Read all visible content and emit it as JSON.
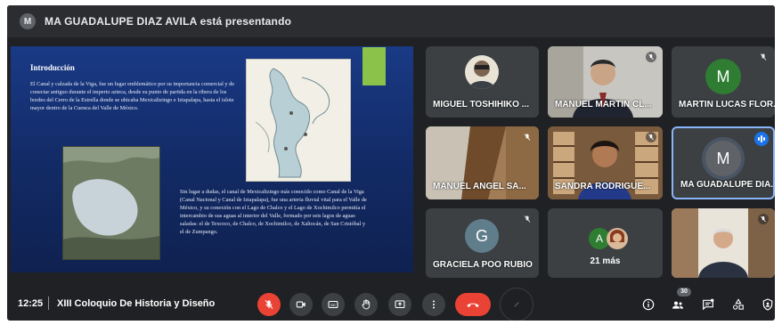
{
  "topbar": {
    "presenter_initial": "M",
    "presenter_text": "MA GUADALUPE DIAZ AVILA está presentando"
  },
  "slide": {
    "title": "Introducción",
    "paragraph_1": "El Canal y calzada de la Viga, fue un lugar emblemático por su importancia comercial y de conectar antiguo durante el imperio azteca, desde su punto de partida en la ribera de los bordes del Cerro de la Estrella donde se ubicaba Mexicaltzingo e Iztapalapa, hasta el islote mayor dentro de la Cuenca del Valle de México.",
    "paragraph_2": "Sin lugar a dudas, el canal de Mexicaltzingo más conocido como Canal de la Viga (Canal Nacional y Canal de Iztapalapa), fue una arteria fluvial vital para el Valle de México, y su conexión con el Lago de Chalco y el Lago de Xochimilco permitía el intercambio de sus aguas al interior del Valle, formado por seis lagos de aguas saladas: el de Texcoco, de Chalco, de Xochimilco, de Xaltocán, de San Cristóbal y el de Zumpango.",
    "accent_color": "#8bc34a"
  },
  "participants": [
    {
      "name": "MIGUEL TOSHIHIKO ...",
      "muted": false
    },
    {
      "name": "MANUEL MARTIN CL...",
      "muted": true
    },
    {
      "name": "MARTIN LUCAS FLOR...",
      "initial": "M",
      "avatar_color": "#2e7d32",
      "muted": true
    },
    {
      "name": "MANUEL ANGEL SA...",
      "muted": true
    },
    {
      "name": "SANDRA RODRIGUE...",
      "muted": true
    },
    {
      "name": "MA GUADALUPE DIA...",
      "initial": "M",
      "avatar_color": "#5f6368",
      "speaking": true
    },
    {
      "name": "GRACIELA POO RUBIO",
      "initial": "G",
      "avatar_color": "#607d8b",
      "muted": true
    },
    {
      "name": "21 más",
      "initial": "A",
      "avatar_color": "#2e7d32"
    },
    {
      "name": "",
      "muted": true
    }
  ],
  "bottombar": {
    "time": "12:25",
    "meeting_title": "XIII Coloquio De Historia y Diseño",
    "people_count": "30",
    "mic_off_color": "#ea4335",
    "leave_color": "#ea4335"
  },
  "icons": [
    "mic-off-icon",
    "camera-icon",
    "captions-icon",
    "raise-hand-icon",
    "present-icon",
    "more-icon",
    "leave-call-icon",
    "info-icon",
    "people-icon",
    "chat-icon",
    "activities-icon",
    "host-controls-icon"
  ]
}
